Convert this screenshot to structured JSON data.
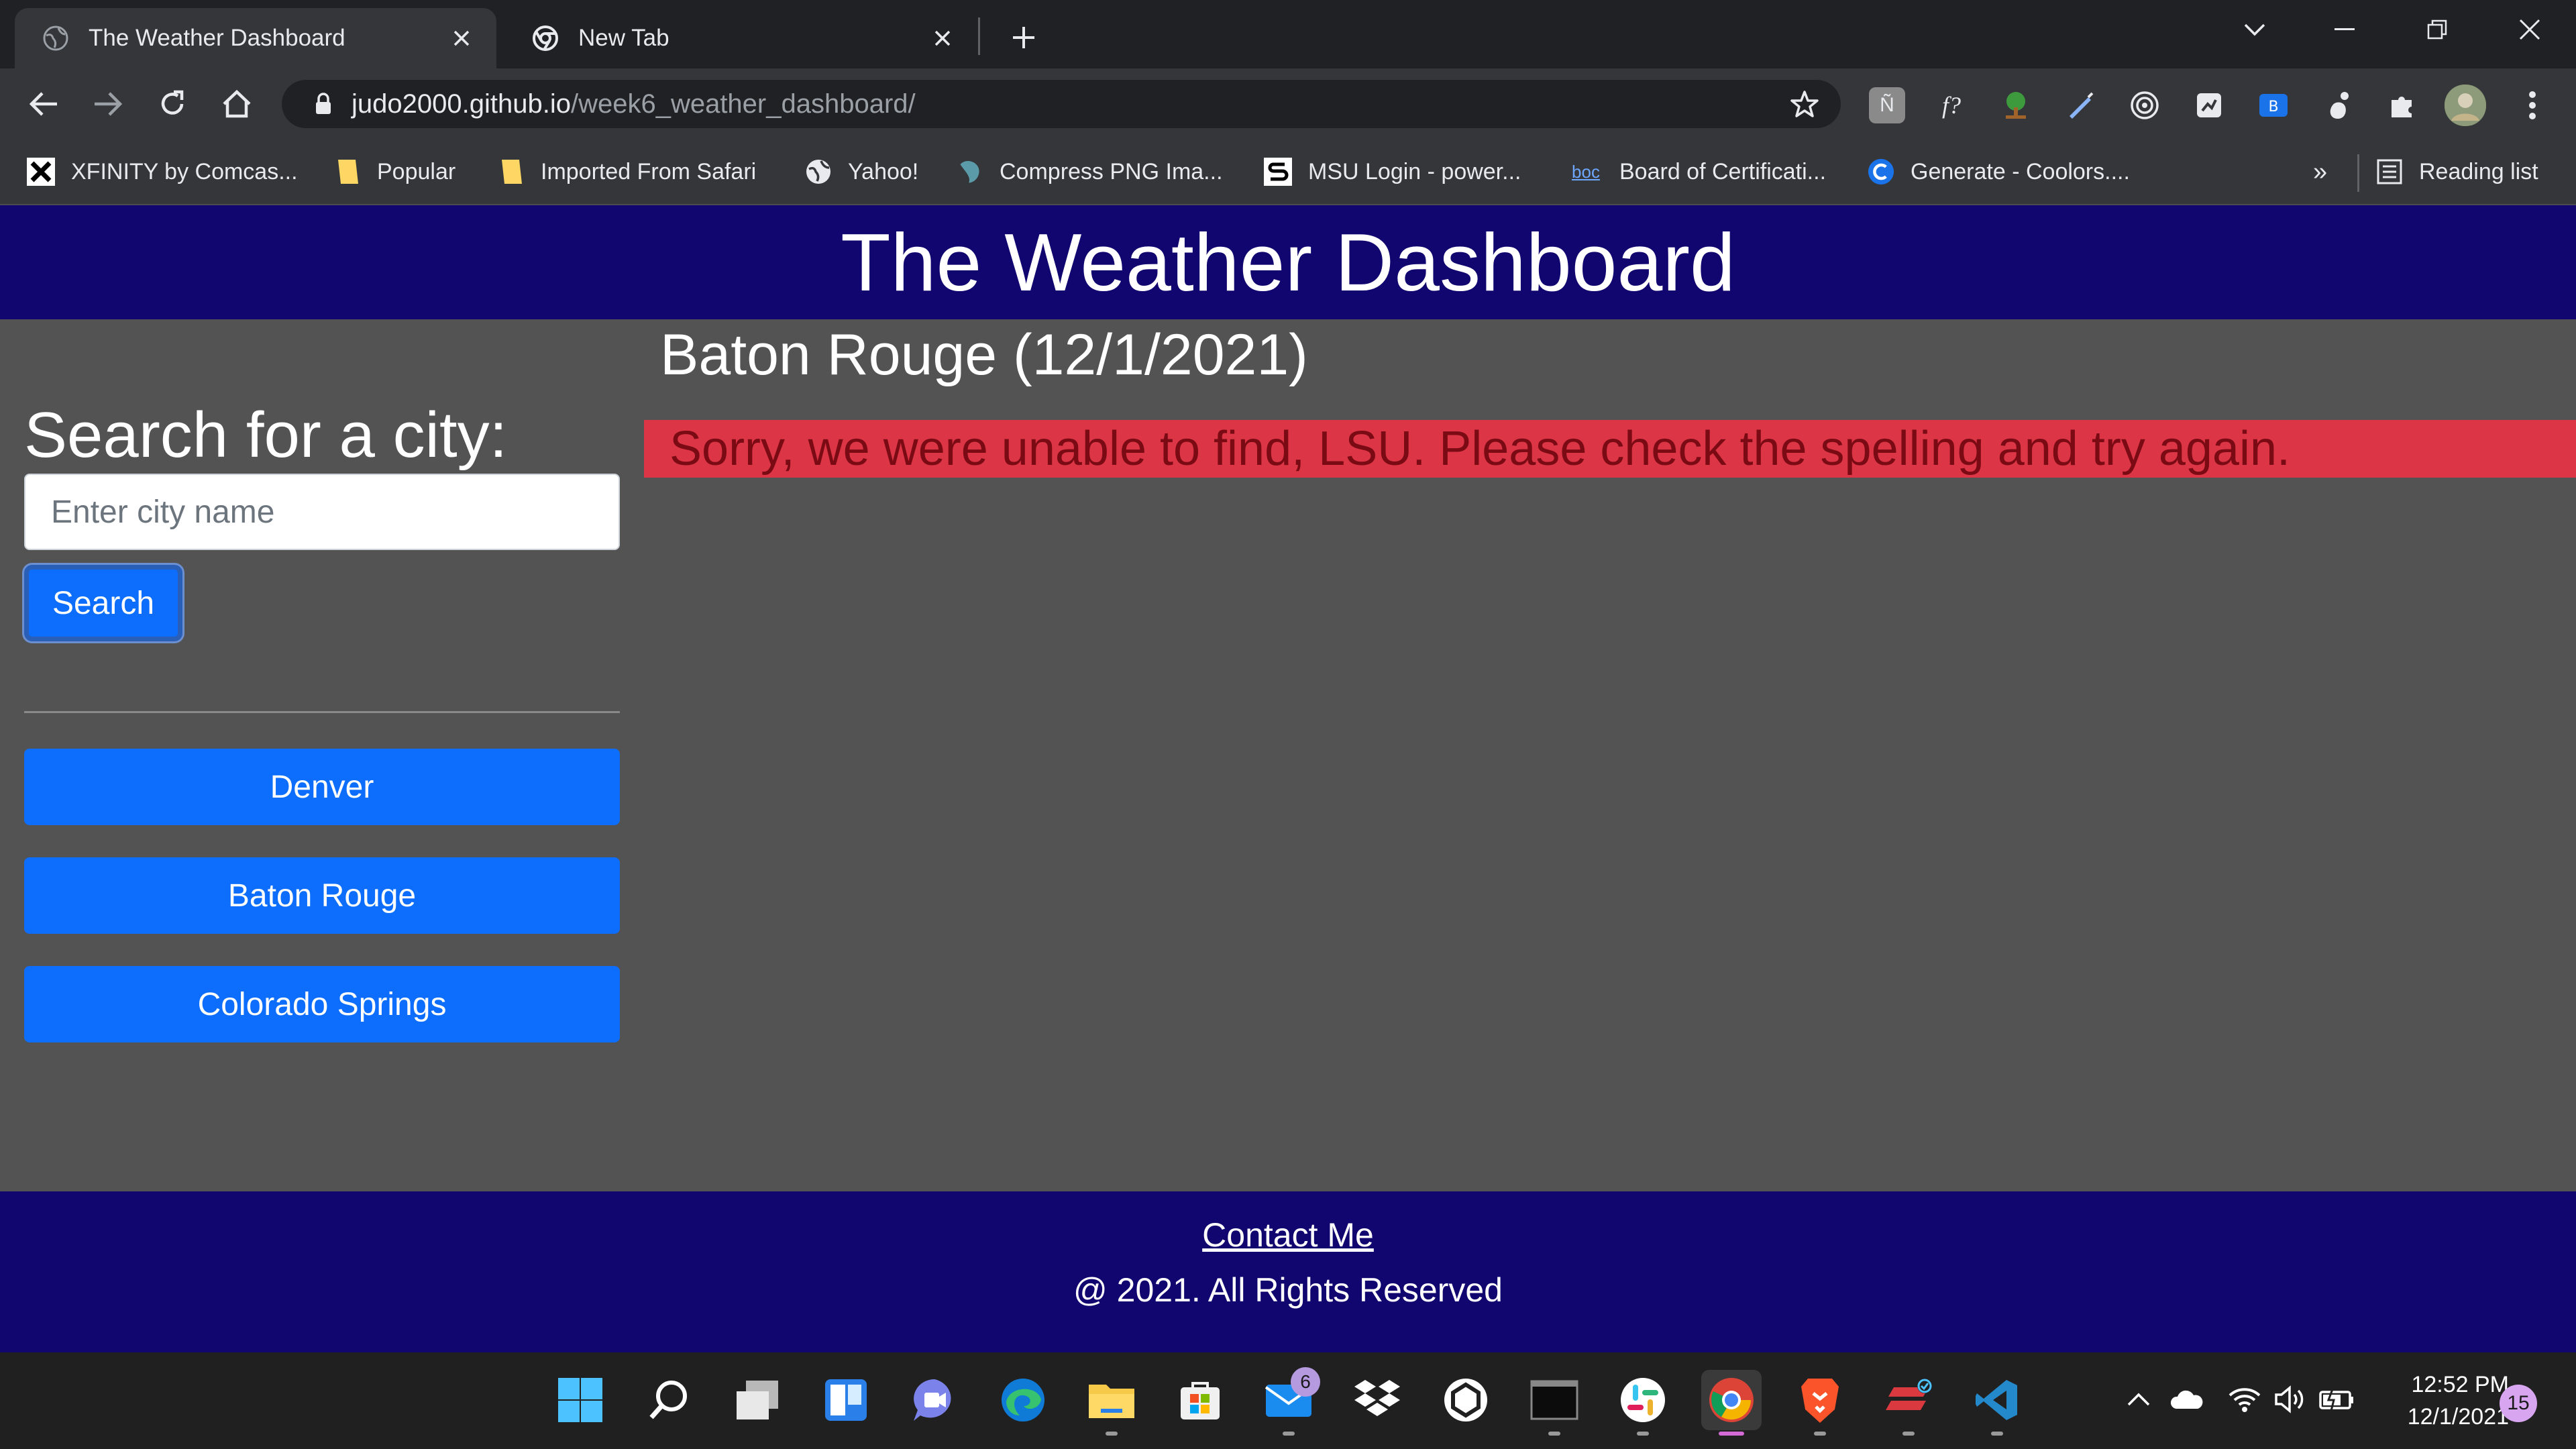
{
  "browser": {
    "tabs": [
      {
        "title": "The Weather Dashboard",
        "active": true
      },
      {
        "title": "New Tab",
        "active": false
      }
    ],
    "url_host": "judo2000.github.io",
    "url_path": "/week6_weather_dashboard/",
    "bookmarks": [
      {
        "label": "XFINITY by Comcas...",
        "icon": "xfinity-icon"
      },
      {
        "label": "Popular",
        "icon": "folder-icon"
      },
      {
        "label": "Imported From Safari",
        "icon": "folder-icon"
      },
      {
        "label": "Yahoo!",
        "icon": "globe-icon"
      },
      {
        "label": "Compress PNG Ima...",
        "icon": "panda-icon"
      },
      {
        "label": "MSU Login - power...",
        "icon": "s-icon"
      },
      {
        "label": "Board of Certificati...",
        "icon": "boc-icon"
      },
      {
        "label": "Generate - Coolors....",
        "icon": "coolors-icon"
      }
    ],
    "overflow_label": "»",
    "reading_list": "Reading list"
  },
  "page": {
    "header_title": "The Weather Dashboard",
    "sidebar": {
      "heading": "Search for a city:",
      "input_placeholder": "Enter city name",
      "input_value": "",
      "search_label": "Search",
      "history": [
        "Denver",
        "Baton Rouge",
        "Colorado Springs"
      ]
    },
    "main": {
      "city_title": "Baton Rouge (12/1/2021)",
      "error_message": "Sorry, we were unable to find, LSU. Please check the spelling and try again."
    },
    "footer": {
      "contact": "Contact Me",
      "copyright": "@ 2021. All Rights Reserved"
    }
  },
  "taskbar": {
    "mail_badge": "6",
    "time": "12:52 PM",
    "date": "12/1/2021",
    "notification_count": "15"
  },
  "colors": {
    "header_bg": "#11066f",
    "page_bg": "#535353",
    "button_primary": "#0d6efd",
    "error_bg": "#dc3545"
  }
}
